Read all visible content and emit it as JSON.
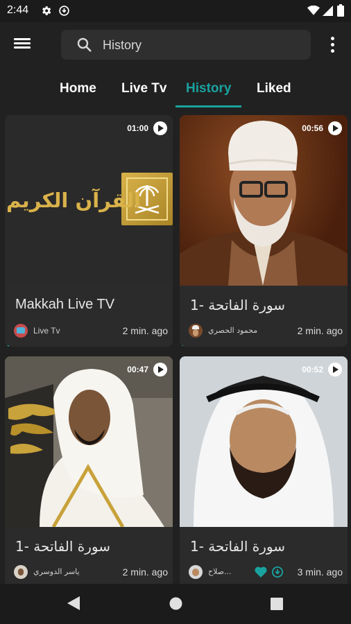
{
  "status_bar": {
    "time": "2:44"
  },
  "toolbar": {
    "search_text": "History"
  },
  "tabs": [
    {
      "label": "Home"
    },
    {
      "label": "Live Tv"
    },
    {
      "label": "History"
    },
    {
      "label": "Liked"
    }
  ],
  "active_tab": "History",
  "accent_color": "#19a3a0",
  "cards": [
    {
      "duration": "01:00",
      "title": "Makkah Live TV",
      "author": "Live Tv",
      "ago": "2 min. ago",
      "logo_text": "القرآن الكريم"
    },
    {
      "duration": "00:56",
      "title": "سورة الفاتحة -1",
      "author": "محمود الحصري",
      "ago": "2 min. ago"
    },
    {
      "duration": "00:47",
      "title": "سورة الفاتحة -1",
      "author": "ياسر الدوسري",
      "ago": "2 min. ago"
    },
    {
      "duration": "00:52",
      "title": "سورة الفاتحة -1",
      "author": "صلاح...",
      "ago": "3 min. ago"
    }
  ]
}
